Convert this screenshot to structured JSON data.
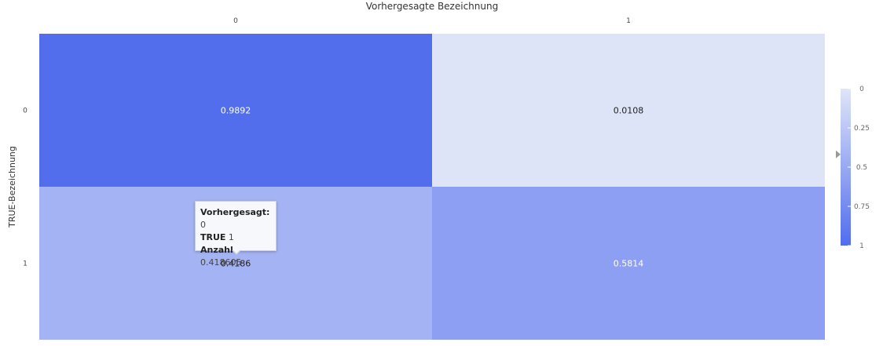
{
  "chart_data": {
    "type": "heatmap",
    "xlabel": "Vorhergesagte Bezeichnung",
    "ylabel": "TRUE-Bezeichnung",
    "x_categories": [
      "0",
      "1"
    ],
    "y_categories": [
      "0",
      "1"
    ],
    "values": [
      [
        0.9892,
        0.0108
      ],
      [
        0.4186,
        0.5814
      ]
    ],
    "value_labels": [
      [
        "0.9892",
        "0.0108"
      ],
      [
        "0.4186",
        "0.5814"
      ]
    ],
    "colorbar": {
      "range": [
        0,
        1
      ],
      "ticks": [
        "0",
        "0.25",
        "0.5",
        "0.75",
        "1"
      ]
    },
    "colors": {
      "low": "#e0e5f8",
      "high": "#516ded"
    }
  },
  "tooltip": {
    "predicted_label": "Vorhergesagt:",
    "predicted_value": "0",
    "true_label": "TRUE",
    "true_value": "1",
    "count_label": "Anzahl",
    "count_value": "0.418605"
  }
}
